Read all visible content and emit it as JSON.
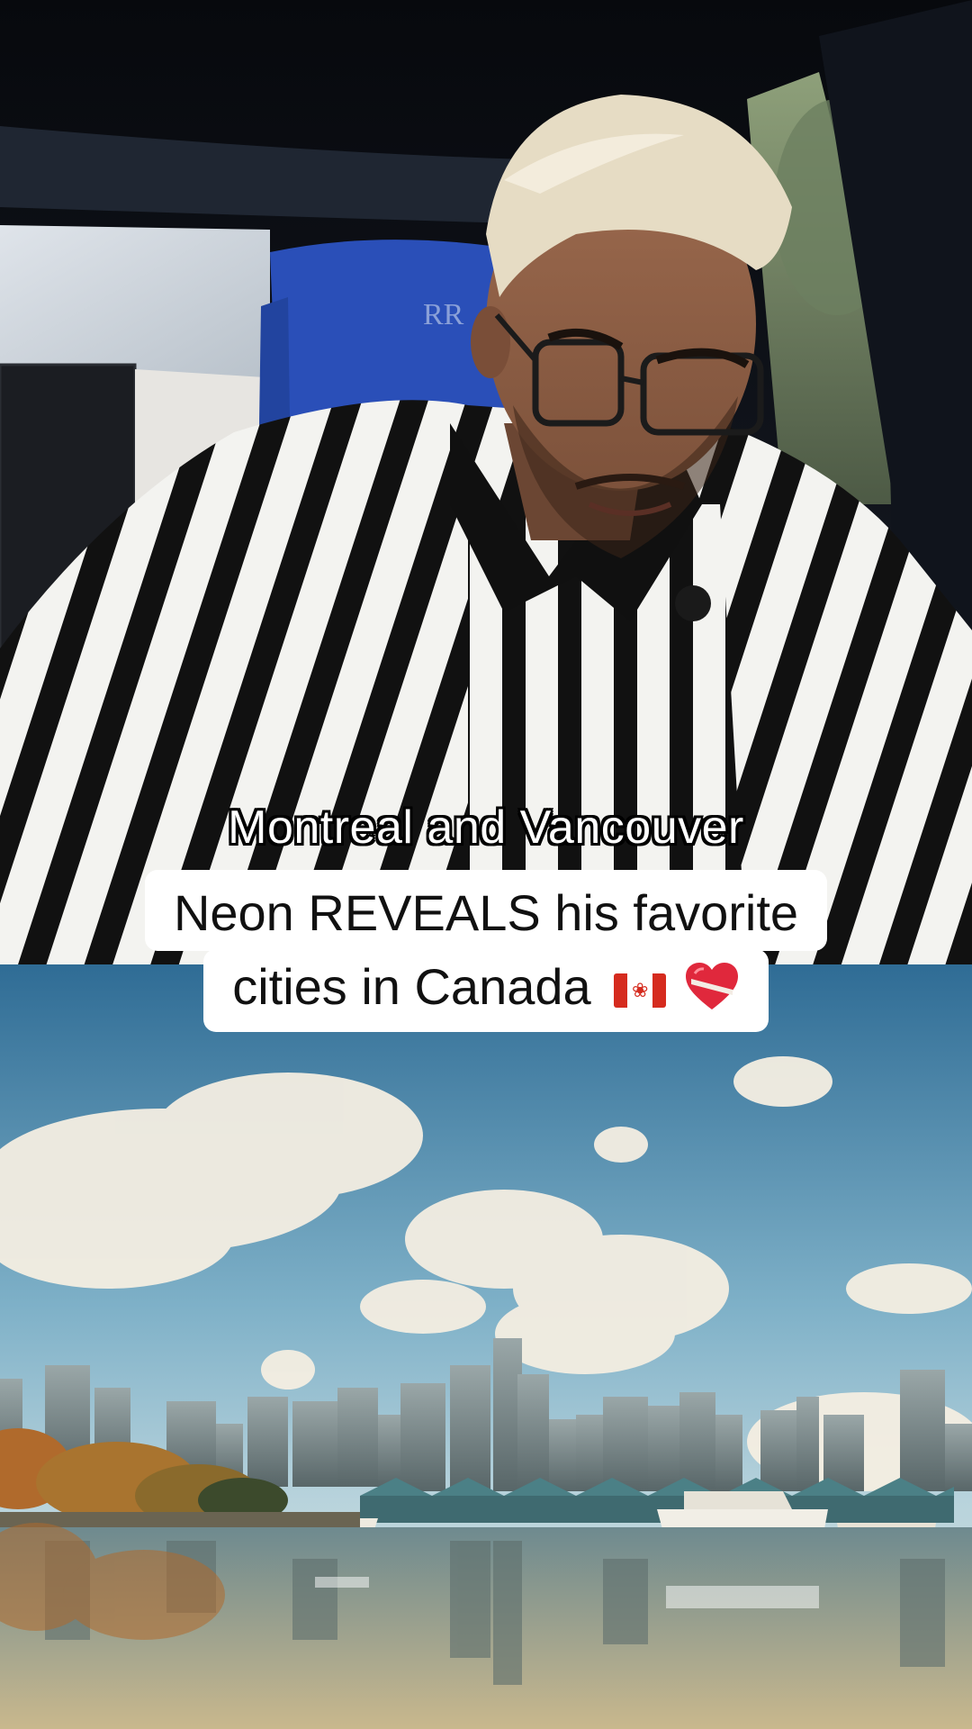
{
  "caption": {
    "subtitle": "Montreal and Vancouver",
    "title_line_1": "Neon REVEALS his favorite",
    "title_line_2": "cities in Canada"
  },
  "title_emojis": [
    "canada-flag",
    "mending-heart"
  ],
  "colors": {
    "caption_text": "#ffffff",
    "caption_outline": "#000000",
    "title_card_bg": "#ffffff",
    "title_text": "#111111",
    "car_seat_blue": "#2a4fb8",
    "flag_red": "#d52b1e"
  }
}
